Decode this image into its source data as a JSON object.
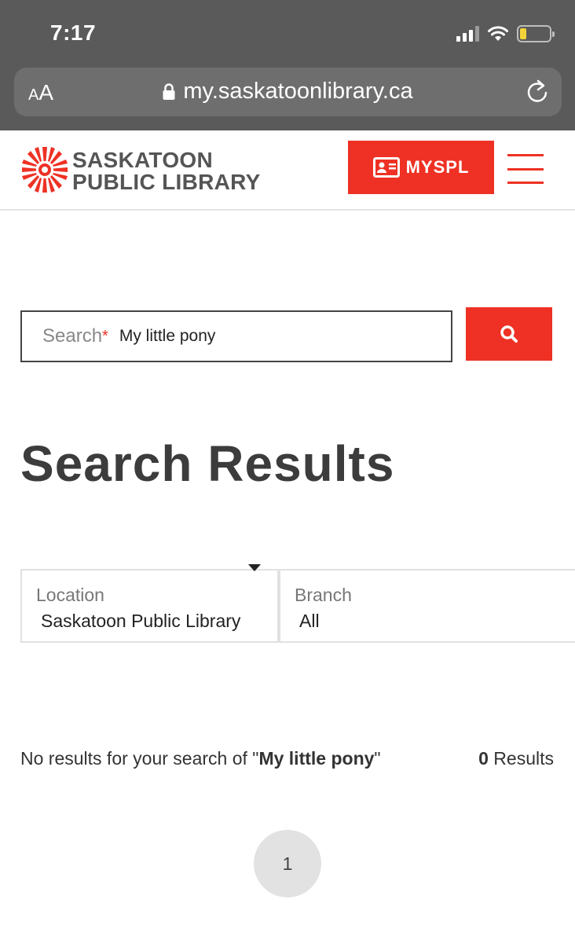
{
  "status_bar": {
    "time": "7:17"
  },
  "browser": {
    "text_size_label_small": "A",
    "text_size_label_large": "A",
    "url": "my.saskatoonlibrary.ca"
  },
  "header": {
    "logo_line1": "SASKATOON",
    "logo_line2": "PUBLIC LIBRARY",
    "account_button_label": "MYSPL",
    "brand_color": "#ee3124"
  },
  "search": {
    "label": "Search",
    "required_mark": "*",
    "value": "My little pony"
  },
  "page_title": "Search Results",
  "filters": {
    "location": {
      "label": "Location",
      "value": "Saskatoon Public Library"
    },
    "branch": {
      "label": "Branch",
      "value": "All"
    }
  },
  "results": {
    "message_prefix": "No results for your search of \"",
    "query": "My little pony",
    "message_suffix": "\"",
    "count": "0",
    "count_label": "Results"
  },
  "pagination": {
    "current_page": "1"
  }
}
